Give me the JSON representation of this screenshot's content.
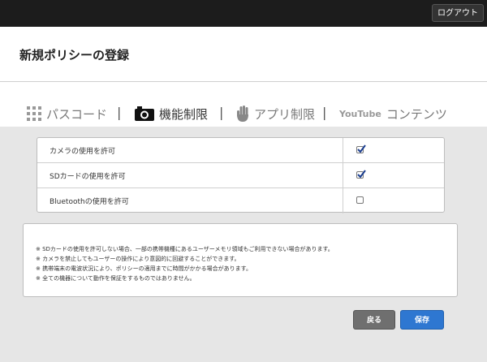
{
  "topbar": {
    "logout_label": "ログアウト"
  },
  "header": {
    "title": "新規ポリシーの登録"
  },
  "tabs": [
    {
      "label": "パスコード",
      "icon": "grid-icon"
    },
    {
      "label": "機能制限",
      "icon": "camera-icon",
      "active": true
    },
    {
      "label": "アプリ制限",
      "icon": "hand-icon"
    },
    {
      "label": "コンテンツ",
      "icon": "youtube-logo-icon",
      "logo_text": "YouTube"
    }
  ],
  "separator": "|",
  "settings": [
    {
      "label": "カメラの使用を許可",
      "checked": true
    },
    {
      "label": "SDカードの使用を許可",
      "checked": true
    },
    {
      "label": "Bluetoothの使用を許可",
      "checked": false
    }
  ],
  "notes": [
    "※ SDカードの使用を許可しない場合、一部の携帯機種にあるユーザーメモリ領域もご利用できない場合があります。",
    "※ カメラを禁止してもユーザーの操作により意図的に回避することができます。",
    "※ 携帯端末の電波状況により、ポリシーの適用までに時間がかかる場合があります。",
    "※ 全ての機器について動作を保証をするものではありません。"
  ],
  "buttons": {
    "back_label": "戻る",
    "save_label": "保存"
  },
  "colors": {
    "topbar": "#1c1c1c",
    "save": "#2e77d1",
    "back": "#6f6f6f"
  }
}
